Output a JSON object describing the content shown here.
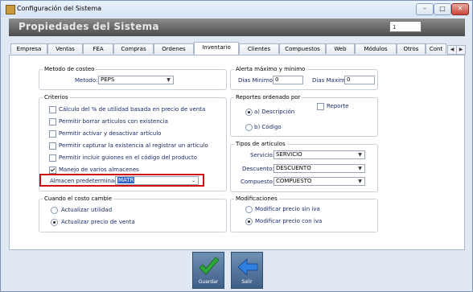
{
  "window": {
    "title": "Configuración del Sistema",
    "controls": [
      "–",
      "□",
      "✕"
    ]
  },
  "header": {
    "title": "Propiedades del Sistema",
    "field_value": "1"
  },
  "tabs": [
    {
      "label": "Empresa"
    },
    {
      "label": "Ventas"
    },
    {
      "label": "FEA"
    },
    {
      "label": "Compras"
    },
    {
      "label": "Ordenes"
    },
    {
      "label": "Inventario"
    },
    {
      "label": "Clientes"
    },
    {
      "label": "Compuestos"
    },
    {
      "label": "Web"
    },
    {
      "label": "Módulos"
    },
    {
      "label": "Otros"
    },
    {
      "label": "Cont"
    }
  ],
  "active_tab": "Inventario",
  "metodo_costeo": {
    "legend": "Metodo de costeo",
    "label": "Metodo:",
    "value": "PEPS"
  },
  "criterios": {
    "legend": "Criterios",
    "items": [
      {
        "label": "Cálculo del % de utilidad basada en precio de venta",
        "checked": false
      },
      {
        "label": "Permitir borrar articulos con existencia",
        "checked": false
      },
      {
        "label": "Permitir activar y desactivar artículo",
        "checked": false
      },
      {
        "label": "Permitir capturar la existencia al registrar un artículo",
        "checked": false
      },
      {
        "label": "Permitir incluir guiones en el código del producto",
        "checked": false
      },
      {
        "label": "Manejo de varios almacenes",
        "checked": true
      }
    ],
    "almacen_label": "Almacen predeterminado:",
    "almacen_value": "MATR"
  },
  "costo_cambie": {
    "legend": "Cuando el costo cambie",
    "options": [
      {
        "label": "Actualizar utilidad",
        "checked": false
      },
      {
        "label": "Actualizar precio de venta",
        "checked": true
      }
    ]
  },
  "alerta": {
    "legend": "Alerta máximo y mínimo",
    "min_label": "Dias Minimo:",
    "min_value": "0",
    "max_label": "Dias Maximo:",
    "max_value": "0"
  },
  "reportes": {
    "legend": "Reportes ordenado por",
    "options": [
      {
        "label": "a) Descripción",
        "checked": true
      },
      {
        "label": "b) Código",
        "checked": false
      }
    ],
    "reporte_label": "Reporte",
    "reporte_checked": false
  },
  "tipos": {
    "legend": "Tipos de artículos",
    "rows": [
      {
        "label": "Servicio:",
        "value": "SERVICIO"
      },
      {
        "label": "Descuento:",
        "value": "DESCUENTO"
      },
      {
        "label": "Compuesto:",
        "value": "COMPUESTO"
      }
    ]
  },
  "modificaciones": {
    "legend": "Modificaciones",
    "options": [
      {
        "label": "Modificar precio sin iva",
        "checked": false
      },
      {
        "label": "Modificar precio con iva",
        "checked": true
      }
    ]
  },
  "buttons": {
    "guardar": "Guardar",
    "salir": "Salir"
  },
  "colors": {
    "highlight_box": "#d01010",
    "selected_text_bg": "#3366cc",
    "guardar_check": "#2fa83a",
    "salir_arrow": "#2f7fe0"
  }
}
